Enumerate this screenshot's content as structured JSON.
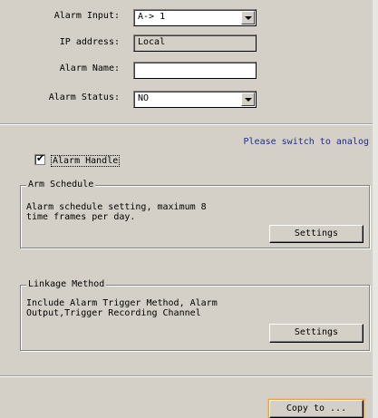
{
  "form": {
    "alarm_input_label": "Alarm Input:",
    "alarm_input_value": "A-> 1",
    "ip_label": "IP address:",
    "ip_value": "Local",
    "alarm_name_label": "Alarm Name:",
    "alarm_name_value": "",
    "alarm_status_label": "Alarm Status:",
    "alarm_status_value": "NO"
  },
  "hint": "Please switch to analog",
  "alarm_handle": {
    "label": "Alarm Handle",
    "checked": true
  },
  "arm_schedule": {
    "title": "Arm Schedule",
    "text": "Alarm schedule setting, maximum 8\ntime frames per day.",
    "button": "Settings"
  },
  "linkage": {
    "title": "Linkage Method",
    "text": "Include Alarm Trigger Method, Alarm\nOutput,Trigger Recording Channel",
    "button": "Settings"
  },
  "copy_button": "Copy to ..."
}
